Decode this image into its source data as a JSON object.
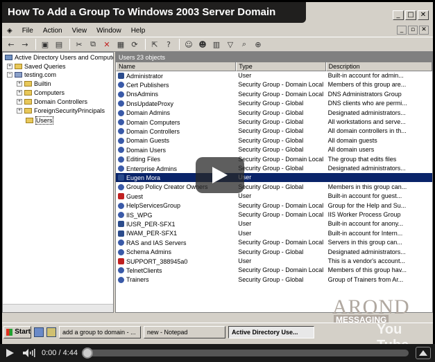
{
  "video": {
    "title": "How To Add a Group To Windows 2003 Server Domain",
    "time_current": "0:00",
    "time_total": "4:44",
    "progress_fraction": 0
  },
  "window": {
    "caption_buttons": [
      "minimize-icon",
      "maximize-icon",
      "close-icon"
    ]
  },
  "menu": {
    "items": [
      "File",
      "Action",
      "View",
      "Window",
      "Help"
    ]
  },
  "tree": {
    "root": "Active Directory Users and Computer",
    "saved_queries": "Saved Queries",
    "domain": "testing.com",
    "children": [
      "Builtin",
      "Computers",
      "Domain Controllers",
      "ForeignSecurityPrincipals",
      "Users"
    ]
  },
  "list": {
    "header": "Users   23 objects",
    "columns": [
      "Name",
      "Type",
      "Description"
    ],
    "rows": [
      {
        "name": "Administrator",
        "type": "User",
        "desc": "Built-in account for admin..."
      },
      {
        "name": "Cert Publishers",
        "type": "Security Group - Domain Local",
        "desc": "Members of this group are..."
      },
      {
        "name": "DnsAdmins",
        "type": "Security Group - Domain Local",
        "desc": "DNS Administrators Group"
      },
      {
        "name": "DnsUpdateProxy",
        "type": "Security Group - Global",
        "desc": "DNS clients who are permi..."
      },
      {
        "name": "Domain Admins",
        "type": "Security Group - Global",
        "desc": "Designated administrators..."
      },
      {
        "name": "Domain Computers",
        "type": "Security Group - Global",
        "desc": "All workstations and serve..."
      },
      {
        "name": "Domain Controllers",
        "type": "Security Group - Global",
        "desc": "All domain controllers in th..."
      },
      {
        "name": "Domain Guests",
        "type": "Security Group - Global",
        "desc": "All domain guests"
      },
      {
        "name": "Domain Users",
        "type": "Security Group - Global",
        "desc": "All domain users"
      },
      {
        "name": "Editing Files",
        "type": "Security Group - Domain Local",
        "desc": "The group that edits files"
      },
      {
        "name": "Enterprise Admins",
        "type": "Security Group - Global",
        "desc": "Designated administrators..."
      },
      {
        "name": "Eugen Mora",
        "type": "User",
        "desc": ""
      },
      {
        "name": "Group Policy Creator Owners",
        "type": "Security Group - Global",
        "desc": "Members in this group can..."
      },
      {
        "name": "Guest",
        "type": "User",
        "desc": "Built-in account for guest..."
      },
      {
        "name": "HelpServicesGroup",
        "type": "Security Group - Domain Local",
        "desc": "Group for the Help and Su..."
      },
      {
        "name": "IIS_WPG",
        "type": "Security Group - Domain Local",
        "desc": "IIS Worker Process Group"
      },
      {
        "name": "IUSR_PER-SFX1",
        "type": "User",
        "desc": "Built-in account for anony..."
      },
      {
        "name": "IWAM_PER-SFX1",
        "type": "User",
        "desc": "Built-in account for Intern..."
      },
      {
        "name": "RAS and IAS Servers",
        "type": "Security Group - Domain Local",
        "desc": "Servers in this group can..."
      },
      {
        "name": "Schema Admins",
        "type": "Security Group - Global",
        "desc": "Designated administrators..."
      },
      {
        "name": "SUPPORT_388945a0",
        "type": "User",
        "desc": "This is a vendor's account..."
      },
      {
        "name": "TelnetClients",
        "type": "Security Group - Domain Local",
        "desc": "Members of this group hav..."
      },
      {
        "name": "Trainers",
        "type": "Security Group - Global",
        "desc": "Group of Trainers from Ar..."
      }
    ]
  },
  "watermark": {
    "brand": "AROND",
    "sub": "MESSAGING",
    "youtube": "You Tube"
  },
  "taskbar": {
    "start_label": "Start",
    "tasks": [
      "add a group to domain - ...",
      "new - Notepad",
      "Active Directory Use..."
    ]
  },
  "colors": {
    "selection": "#0a246a",
    "window_bg": "#d4d0c8"
  }
}
